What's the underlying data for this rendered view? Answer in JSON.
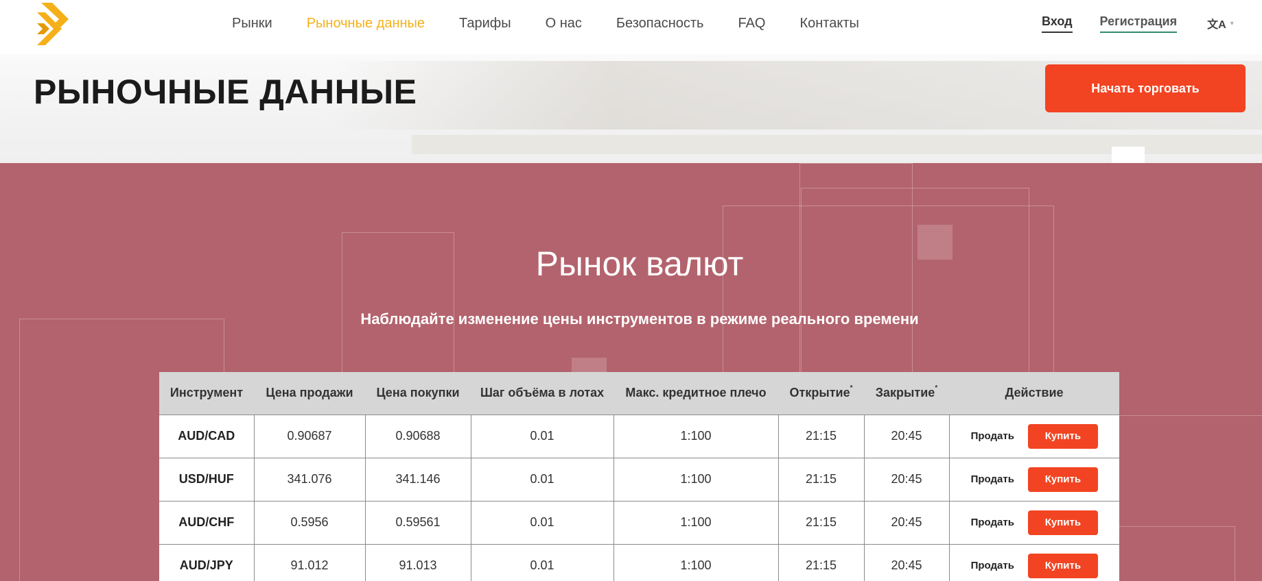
{
  "brand": {
    "logo": "logo-icon",
    "primary_color": "#f5b019",
    "accent_color": "#f24422",
    "section_bg": "#b3636d"
  },
  "nav": {
    "items": [
      {
        "label": "Рынки",
        "active": false
      },
      {
        "label": "Рыночные данные",
        "active": true
      },
      {
        "label": "Тарифы",
        "active": false
      },
      {
        "label": "О нас",
        "active": false
      },
      {
        "label": "Безопасность",
        "active": false
      },
      {
        "label": "FAQ",
        "active": false
      },
      {
        "label": "Контакты",
        "active": false
      }
    ],
    "login": "Вход",
    "register": "Регистрация",
    "language_icon": "translate-icon"
  },
  "hero": {
    "title": "РЫНОЧНЫЕ ДАННЫЕ",
    "cta": "Начать торговать"
  },
  "market": {
    "title": "Рынок валют",
    "subtitle": "Наблюдайте изменение цены инструментов в режиме реального времени",
    "columns": [
      "Инструмент",
      "Цена продажи",
      "Цена покупки",
      "Шаг объёма в лотах",
      "Макс. кредитное плечо",
      "Открытие",
      "Закрытие",
      "Действие"
    ],
    "column_footnote_mark": "*",
    "sell_label": "Продать",
    "buy_label": "Купить",
    "rows": [
      {
        "instrument": "AUD/CAD",
        "bid": "0.90687",
        "ask": "0.90688",
        "step": "0.01",
        "leverage": "1:100",
        "open": "21:15",
        "close": "20:45"
      },
      {
        "instrument": "USD/HUF",
        "bid": "341.076",
        "ask": "341.146",
        "step": "0.01",
        "leverage": "1:100",
        "open": "21:15",
        "close": "20:45"
      },
      {
        "instrument": "AUD/CHF",
        "bid": "0.5956",
        "ask": "0.59561",
        "step": "0.01",
        "leverage": "1:100",
        "open": "21:15",
        "close": "20:45"
      },
      {
        "instrument": "AUD/JPY",
        "bid": "91.012",
        "ask": "91.013",
        "step": "0.01",
        "leverage": "1:100",
        "open": "21:15",
        "close": "20:45"
      }
    ]
  }
}
